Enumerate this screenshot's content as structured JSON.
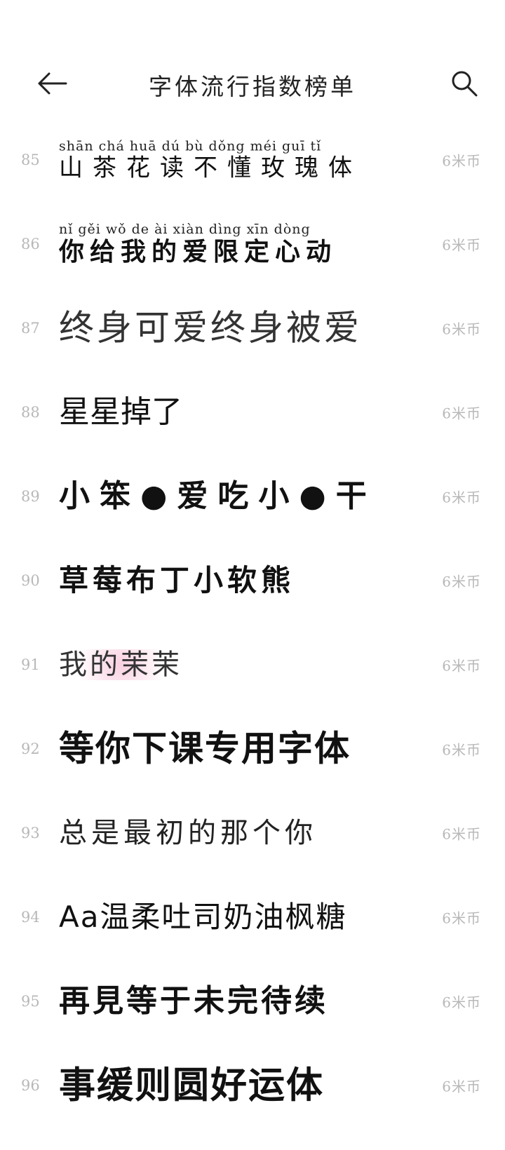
{
  "header": {
    "title": "字体流行指数榜单",
    "back_icon": "back-arrow-icon",
    "search_icon": "search-icon"
  },
  "rows": [
    {
      "rank": "85",
      "pinyin": "shān chá huā dú bù dǒng méi guī tǐ",
      "name": "山茶花读不懂玫瑰体",
      "price": "6米币"
    },
    {
      "rank": "86",
      "pinyin": "nǐ gěi wǒ de ài xiàn dìng xīn dòng",
      "name": "你给我的爱限定心动",
      "price": "6米币"
    },
    {
      "rank": "87",
      "pinyin": "",
      "name": "终身可爱终身被爱",
      "price": "6米币"
    },
    {
      "rank": "88",
      "pinyin": "",
      "name": "星星掉了",
      "price": "6米币"
    },
    {
      "rank": "89",
      "pinyin": "",
      "name": "小笨●爱吃小●干",
      "price": "6米币"
    },
    {
      "rank": "90",
      "pinyin": "",
      "name": "草莓布丁小软熊",
      "price": "6米币"
    },
    {
      "rank": "91",
      "pinyin": "",
      "name": "我的茉茉",
      "price": "6米币"
    },
    {
      "rank": "92",
      "pinyin": "",
      "name": "等你下课专用字体",
      "price": "6米币"
    },
    {
      "rank": "93",
      "pinyin": "",
      "name": "总是最初的那个你",
      "price": "6米币"
    },
    {
      "rank": "94",
      "pinyin": "",
      "name": "Aa温柔吐司奶油枫糖",
      "price": "6米币"
    },
    {
      "rank": "95",
      "pinyin": "",
      "name": "再見等于未完待续",
      "price": "6米币"
    },
    {
      "rank": "96",
      "pinyin": "",
      "name": "事缓则圆好运体",
      "price": "6米币"
    }
  ]
}
